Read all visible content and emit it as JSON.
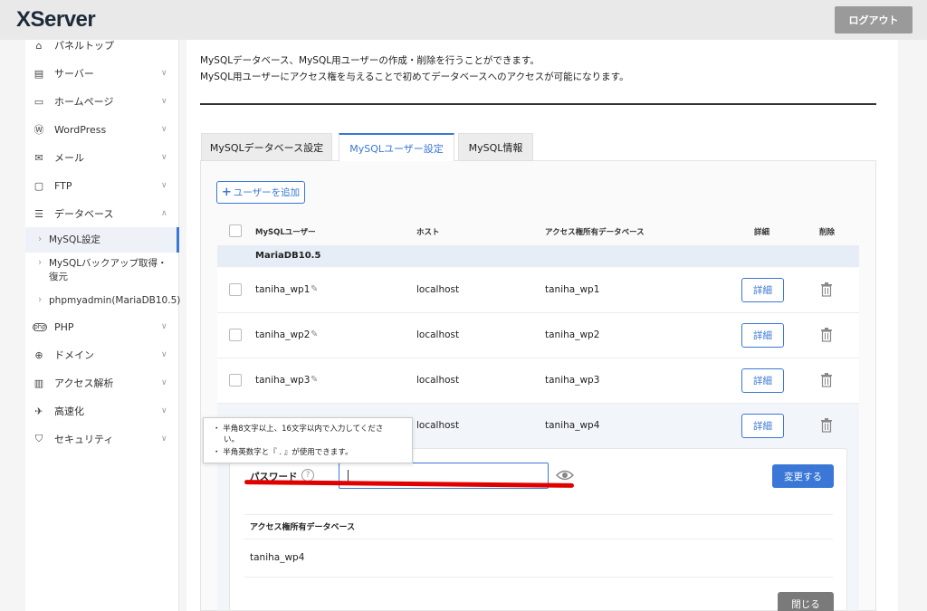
{
  "header": {
    "logo": "XServer",
    "logout_label": "ログアウト"
  },
  "sidebar": {
    "items": [
      {
        "label": "パネルトップ",
        "icon": "home-icon"
      },
      {
        "label": "サーバー",
        "icon": "server-icon"
      },
      {
        "label": "ホームページ",
        "icon": "browser-icon"
      },
      {
        "label": "WordPress",
        "icon": "wordpress-icon"
      },
      {
        "label": "メール",
        "icon": "mail-icon"
      },
      {
        "label": "FTP",
        "icon": "monitor-icon"
      },
      {
        "label": "データベース",
        "icon": "database-icon"
      },
      {
        "label": "PHP",
        "icon": "php-icon"
      },
      {
        "label": "ドメイン",
        "icon": "globe-icon"
      },
      {
        "label": "アクセス解析",
        "icon": "chart-icon"
      },
      {
        "label": "高速化",
        "icon": "speed-icon"
      },
      {
        "label": "セキュリティ",
        "icon": "shield-icon"
      }
    ],
    "sub_items": [
      {
        "label": "MySQL設定"
      },
      {
        "label": "MySQLバックアップ取得・復元"
      },
      {
        "label": "phpmyadmin(MariaDB10.5)"
      }
    ]
  },
  "description": {
    "line1": "MySQLデータベース、MySQL用ユーザーの作成・削除を行うことができます。",
    "line2": "MySQL用ユーザーにアクセス権を与えることで初めてデータベースへのアクセスが可能になります。"
  },
  "tabs": [
    {
      "label": "MySQLデータベース設定"
    },
    {
      "label": "MySQLユーザー設定"
    },
    {
      "label": "MySQL情報"
    }
  ],
  "add_user_label": "ユーザーを追加",
  "table": {
    "headers": {
      "user": "MySQLユーザー",
      "host": "ホスト",
      "db": "アクセス権所有データベース",
      "detail": "詳細",
      "delete": "削除"
    },
    "group": "MariaDB10.5",
    "rows": [
      {
        "user": "taniha_wp1",
        "host": "localhost",
        "db": "taniha_wp1",
        "detail": "詳細"
      },
      {
        "user": "taniha_wp2",
        "host": "localhost",
        "db": "taniha_wp2",
        "detail": "詳細"
      },
      {
        "user": "taniha_wp3",
        "host": "localhost",
        "db": "taniha_wp3",
        "detail": "詳細"
      },
      {
        "user": "",
        "host": "localhost",
        "db": "taniha_wp4",
        "detail": "詳細"
      }
    ]
  },
  "tooltip": {
    "line1": "・ 半角8文字以上、16文字以内で入力してくださ",
    "line1b": "い。",
    "line2": "・ 半角英数字と『 . 』が使用できます。"
  },
  "expanded": {
    "password_label": "パスワード",
    "password_value": "",
    "change_label": "変更する",
    "db_header": "アクセス権所有データベース",
    "db_value": "taniha_wp4",
    "close_label": "閉じる"
  },
  "colors": {
    "accent": "#3a77d6",
    "annotation": "#e00000"
  }
}
